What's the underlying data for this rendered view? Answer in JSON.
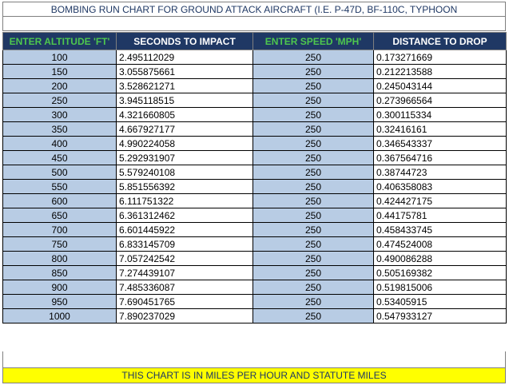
{
  "title": "BOMBING RUN CHART FOR GROUND ATTACK AIRCRAFT (I.E. P-47D, BF-110C, TYPHOON",
  "headers": {
    "altitude": "ENTER ALTITUDE 'FT'",
    "seconds": "SECONDS TO IMPACT",
    "speed": "ENTER SPEED 'MPH'",
    "distance": "DISTANCE TO DROP"
  },
  "rows": [
    {
      "altitude": "100",
      "seconds": "2.495112029",
      "speed": "250",
      "distance": "0.173271669"
    },
    {
      "altitude": "150",
      "seconds": "3.055875661",
      "speed": "250",
      "distance": "0.212213588"
    },
    {
      "altitude": "200",
      "seconds": "3.528621271",
      "speed": "250",
      "distance": "0.245043144"
    },
    {
      "altitude": "250",
      "seconds": "3.945118515",
      "speed": "250",
      "distance": "0.273966564"
    },
    {
      "altitude": "300",
      "seconds": "4.321660805",
      "speed": "250",
      "distance": "0.300115334"
    },
    {
      "altitude": "350",
      "seconds": "4.667927177",
      "speed": "250",
      "distance": "0.32416161"
    },
    {
      "altitude": "400",
      "seconds": "4.990224058",
      "speed": "250",
      "distance": "0.346543337"
    },
    {
      "altitude": "450",
      "seconds": "5.292931907",
      "speed": "250",
      "distance": "0.367564716"
    },
    {
      "altitude": "500",
      "seconds": "5.579240108",
      "speed": "250",
      "distance": "0.38744723"
    },
    {
      "altitude": "550",
      "seconds": "5.851556392",
      "speed": "250",
      "distance": "0.406358083"
    },
    {
      "altitude": "600",
      "seconds": "6.111751322",
      "speed": "250",
      "distance": "0.424427175"
    },
    {
      "altitude": "650",
      "seconds": "6.361312462",
      "speed": "250",
      "distance": "0.44175781"
    },
    {
      "altitude": "700",
      "seconds": "6.601445922",
      "speed": "250",
      "distance": "0.458433745"
    },
    {
      "altitude": "750",
      "seconds": "6.833145709",
      "speed": "250",
      "distance": "0.474524008"
    },
    {
      "altitude": "800",
      "seconds": "7.057242542",
      "speed": "250",
      "distance": "0.490086288"
    },
    {
      "altitude": "850",
      "seconds": "7.274439107",
      "speed": "250",
      "distance": "0.505169382"
    },
    {
      "altitude": "900",
      "seconds": "7.485336087",
      "speed": "250",
      "distance": "0.519815006"
    },
    {
      "altitude": "950",
      "seconds": "7.690451765",
      "speed": "250",
      "distance": "0.53405915"
    },
    {
      "altitude": "1000",
      "seconds": "7.890237029",
      "speed": "250",
      "distance": "0.547933127"
    }
  ],
  "footer": "THIS CHART IS IN MILES PER HOUR AND STATUTE MILES",
  "colors": {
    "header_bg": "#1f3864",
    "input_header_text": "#4ec74e",
    "input_cell_bg": "#b8cce4",
    "footer_bg": "#ffff00"
  }
}
